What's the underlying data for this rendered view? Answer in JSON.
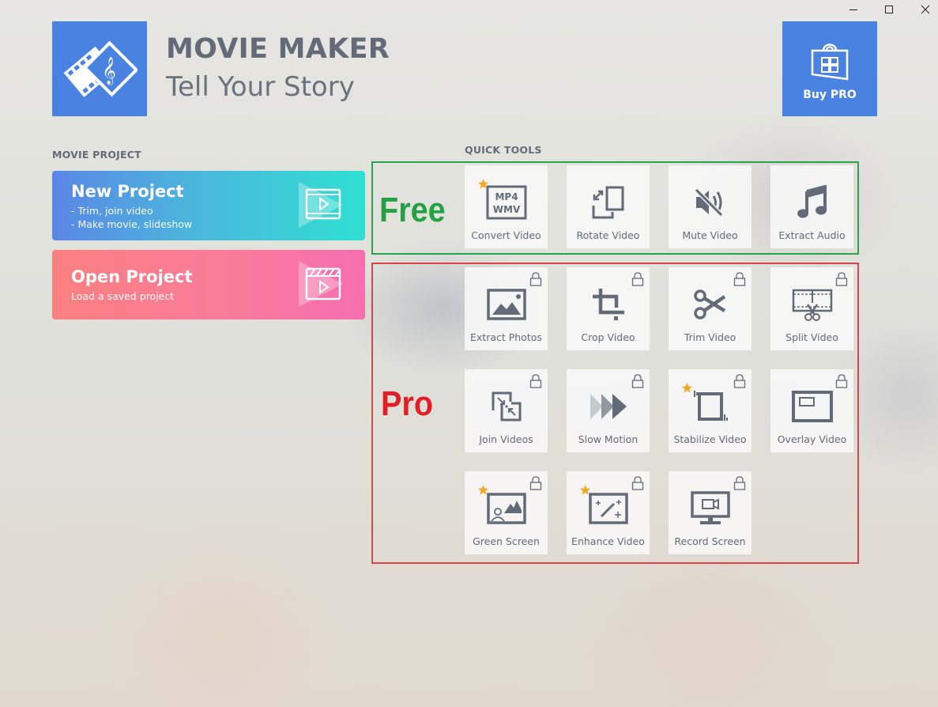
{
  "window": {
    "controls": [
      "minimize",
      "maximize",
      "close"
    ]
  },
  "header": {
    "app_title": "MOVIE MAKER",
    "app_subtitle": "Tell Your Story",
    "logo_icon": "film-music-icon",
    "buy_pro": {
      "label": "Buy PRO",
      "icon": "store-bag-icon"
    }
  },
  "movie_project": {
    "section_label": "MOVIE PROJECT",
    "new_project": {
      "title": "New Project",
      "lines": [
        "- Trim, join video",
        "- Make movie, slideshow"
      ],
      "icon": "film-play-icon"
    },
    "open_project": {
      "title": "Open Project",
      "lines": [
        "Load a saved project"
      ],
      "icon": "clapper-play-icon"
    }
  },
  "quick_tools": {
    "section_label": "QUICK TOOLS",
    "free_tag": "Free",
    "pro_tag": "Pro",
    "colors": {
      "free": "#24a045",
      "pro": "#e21f27",
      "accent": "#4a82e2"
    },
    "free_tools": [
      {
        "label": "Convert Video",
        "icon": "mp4-wmv-icon",
        "starred": true,
        "locked": false,
        "icon_text": [
          "MP4",
          "WMV"
        ]
      },
      {
        "label": "Rotate Video",
        "icon": "rotate-icon",
        "starred": false,
        "locked": false
      },
      {
        "label": "Mute Video",
        "icon": "mute-speaker-icon",
        "starred": false,
        "locked": false
      },
      {
        "label": "Extract Audio",
        "icon": "music-note-icon",
        "starred": false,
        "locked": false
      }
    ],
    "pro_tools": [
      {
        "label": "Extract Photos",
        "icon": "image-icon",
        "starred": false,
        "locked": true
      },
      {
        "label": "Crop Video",
        "icon": "crop-icon",
        "starred": false,
        "locked": true
      },
      {
        "label": "Trim Video",
        "icon": "scissors-icon",
        "starred": false,
        "locked": true
      },
      {
        "label": "Split Video",
        "icon": "film-scissors-icon",
        "starred": false,
        "locked": true
      },
      {
        "label": "Join Videos",
        "icon": "join-icon",
        "starred": false,
        "locked": true
      },
      {
        "label": "Slow Motion",
        "icon": "fast-forward-icon",
        "starred": false,
        "locked": true
      },
      {
        "label": "Stabilize Video",
        "icon": "stabilize-icon",
        "starred": true,
        "locked": true
      },
      {
        "label": "Overlay Video",
        "icon": "overlay-icon",
        "starred": false,
        "locked": true
      },
      {
        "label": "Green Screen",
        "icon": "green-screen-icon",
        "starred": true,
        "locked": true
      },
      {
        "label": "Enhance Video",
        "icon": "magic-wand-icon",
        "starred": true,
        "locked": true
      },
      {
        "label": "Record Screen",
        "icon": "monitor-camera-icon",
        "starred": false,
        "locked": true
      }
    ]
  }
}
